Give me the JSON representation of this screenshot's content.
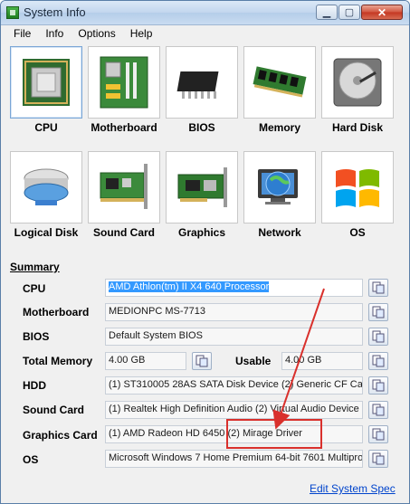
{
  "window": {
    "title": "System Info",
    "min": "▁",
    "max": "▢",
    "close": "✕"
  },
  "menu": [
    "File",
    "Info",
    "Options",
    "Help"
  ],
  "tiles": [
    {
      "label": "CPU",
      "icon": "cpu-icon"
    },
    {
      "label": "Motherboard",
      "icon": "motherboard-icon"
    },
    {
      "label": "BIOS",
      "icon": "bios-chip-icon"
    },
    {
      "label": "Memory",
      "icon": "memory-icon"
    },
    {
      "label": "Hard Disk",
      "icon": "hard-disk-icon"
    },
    {
      "label": "Logical Disk",
      "icon": "logical-disk-icon"
    },
    {
      "label": "Sound Card",
      "icon": "sound-card-icon"
    },
    {
      "label": "Graphics",
      "icon": "graphics-card-icon"
    },
    {
      "label": "Network",
      "icon": "network-globe-icon"
    },
    {
      "label": "OS",
      "icon": "windows-logo-icon"
    }
  ],
  "summary": {
    "title": "Summary",
    "cpu_label": "CPU",
    "cpu_value": "AMD Athlon(tm) II X4 640 Processor",
    "motherboard_label": "Motherboard",
    "motherboard_value": "MEDIONPC MS-7713",
    "bios_label": "BIOS",
    "bios_value": "Default System BIOS",
    "total_memory_label": "Total Memory",
    "total_memory_value": "4.00 GB",
    "usable_label": "Usable",
    "usable_value": "4.00 GB",
    "hdd_label": "HDD",
    "hdd_value": "(1) ST310005 28AS SATA Disk Device  (2) Generic CF Ca",
    "sound_label": "Sound Card",
    "sound_value": "(1) Realtek High Definition Audio  (2) Virtual Audio Device",
    "graphics_label": "Graphics Card",
    "graphics_value": "(1) AMD Radeon HD 6450  (2) Mirage Driver",
    "os_label": "OS",
    "os_value": "Microsoft Windows 7 Home Premium  64-bit 7601 Multiproc"
  },
  "edit_link": "Edit System Spec",
  "colors": {
    "annotation": "#d9302c",
    "selection": "#3399ff",
    "link": "#0044cc"
  }
}
